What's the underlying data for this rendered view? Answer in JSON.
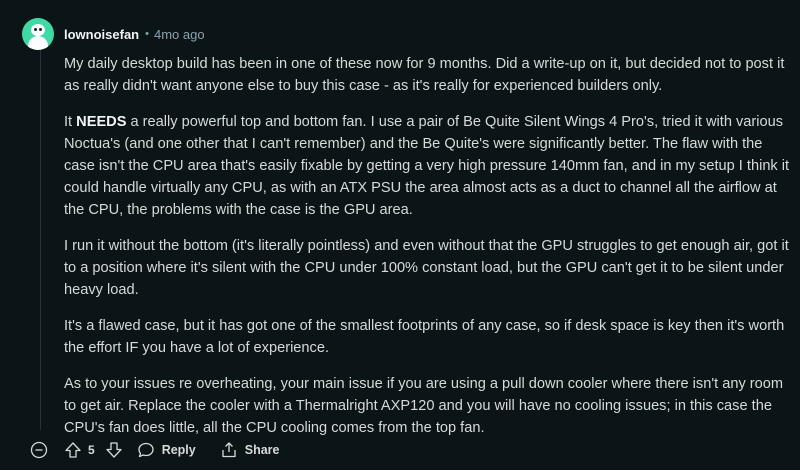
{
  "comment": {
    "username": "lownoisefan",
    "separator": "•",
    "time": "4mo ago",
    "paragraphs": {
      "p1": "My daily desktop build has been in one of these now for 9 months. Did a write-up on it, but decided not to post it as really didn't want anyone else to buy this case - as it's really for experienced builders only.",
      "p2_before": "It ",
      "p2_bold": "NEEDS",
      "p2_after": " a really powerful top and bottom fan. I use a pair of Be Quite Silent Wings 4 Pro's, tried it with various Noctua's (and one other that I can't remember) and the Be Quite's were significantly better. The flaw with the case isn't the CPU area that's easily fixable by getting a very high pressure 140mm fan, and in my setup I think it could handle virtually any CPU, as with an ATX PSU the area almost acts as a duct to channel all the airflow at the CPU, the problems with the case is the GPU area.",
      "p3": "I run it without the bottom (it's literally pointless) and even without that the GPU struggles to get enough air, got it to a position where it's silent with the CPU under 100% constant load, but the GPU can't get it to be silent under heavy load.",
      "p4": "It's a flawed case, but it has got one of the smallest footprints of any case, so if desk space is key then it's worth the effort IF you have a lot of experience.",
      "p5": "As to your issues re overheating, your main issue if you are using a pull down cooler where there isn't any room to get air. Replace the cooler with a Thermalright AXP120 and you will have no cooling issues; in this case the CPU's fan does little, all the CPU cooling comes from the top fan."
    },
    "actions": {
      "score": "5",
      "reply_label": "Reply",
      "share_label": "Share"
    },
    "icons": {
      "avatar": "snoo-avatar",
      "collapse": "minus-circle-icon",
      "upvote": "upvote-arrow-icon",
      "downvote": "downvote-arrow-icon",
      "reply": "speech-bubble-icon",
      "share": "share-arrow-icon"
    },
    "colors": {
      "background": "#0b1416",
      "avatar_bg": "#3fd9a4",
      "text": "#d7dadc",
      "muted": "#8ba2ad"
    }
  }
}
